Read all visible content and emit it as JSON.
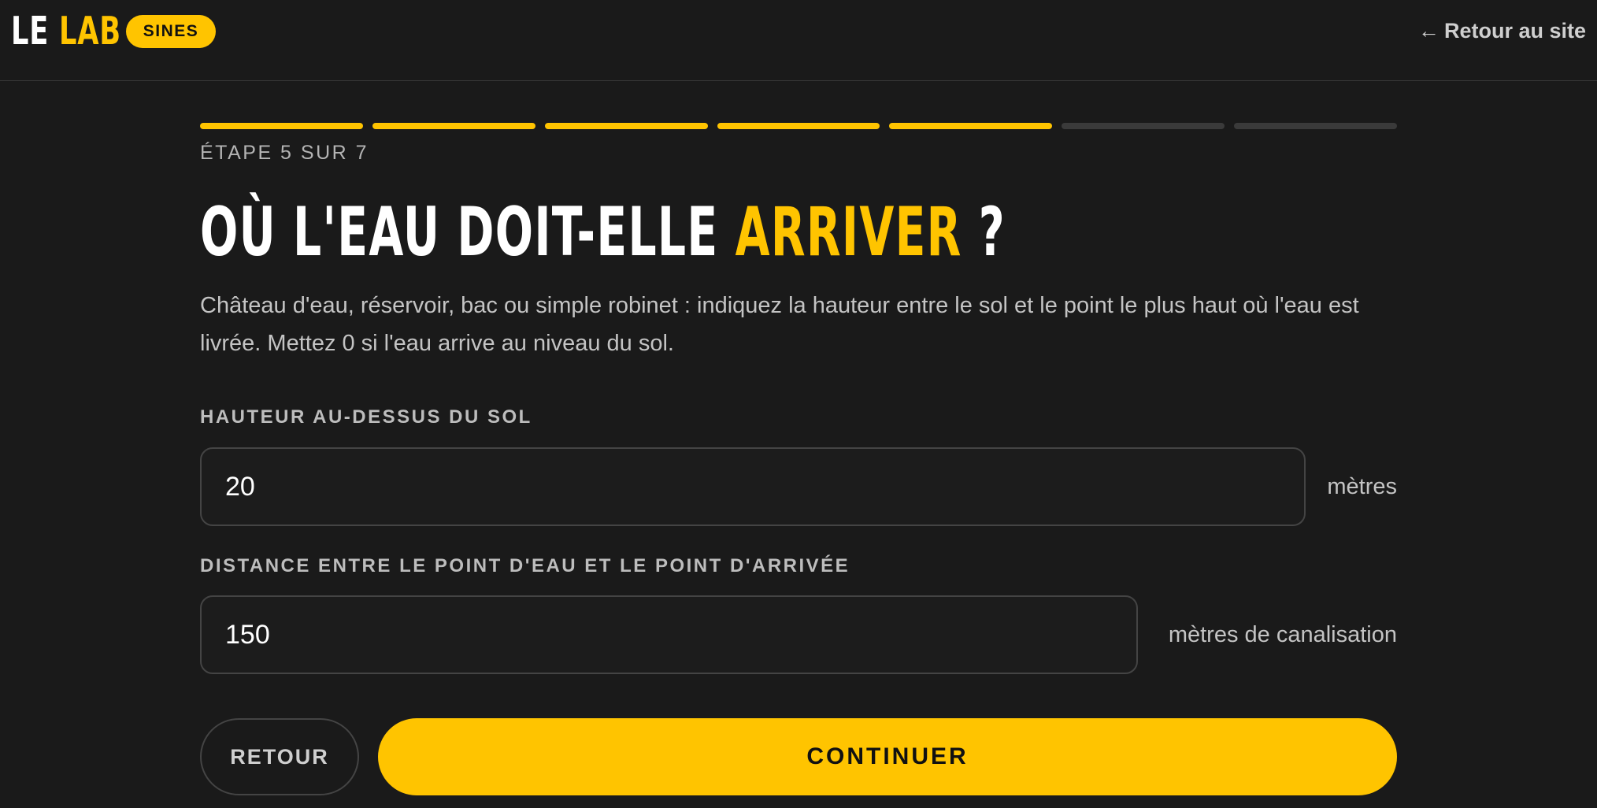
{
  "header": {
    "brand_le": "LE",
    "brand_lab": "LAB",
    "badge": "SINES",
    "back_arrow": "←",
    "back_label": "Retour au site"
  },
  "progress": {
    "current_step": 5,
    "total_steps": 7,
    "completed_color": "#ffc400",
    "pending_color": "#3a3a3a",
    "label": "ÉTAPE 5 SUR 7"
  },
  "question": {
    "title_part1": "OÙ L'EAU DOIT-ELLE",
    "title_accent": "ARRIVER",
    "title_part2": "?",
    "description": "Château d'eau, réservoir, bac ou simple robinet : indiquez la hauteur entre le sol et le point le plus haut où l'eau est livrée. Mettez 0 si l'eau arrive au niveau du sol."
  },
  "fields": {
    "height": {
      "label": "HAUTEUR AU-DESSUS DU SOL",
      "value": "20",
      "unit": "mètres"
    },
    "distance": {
      "label": "DISTANCE ENTRE LE POINT D'EAU ET LE POINT D'ARRIVÉE",
      "value": "150",
      "unit": "mètres de canalisation"
    }
  },
  "actions": {
    "back_label": "RETOUR",
    "continue_label": "CONTINUER"
  },
  "colors": {
    "accent": "#ffc400",
    "background": "#1a1a1a"
  }
}
